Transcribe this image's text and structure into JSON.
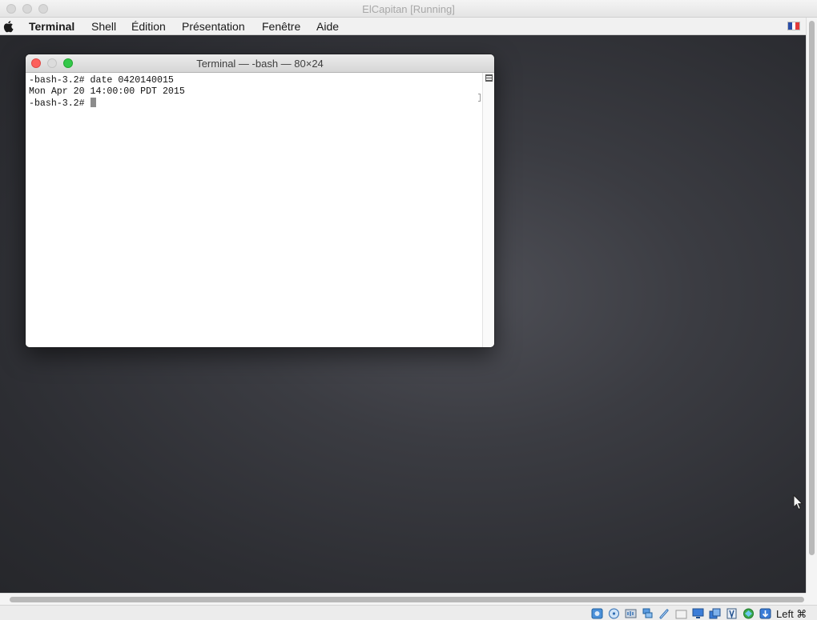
{
  "host_window": {
    "title": "ElCapitan [Running]"
  },
  "menubar": {
    "items": [
      {
        "label": "Terminal"
      },
      {
        "label": "Shell"
      },
      {
        "label": "Édition"
      },
      {
        "label": "Présentation"
      },
      {
        "label": "Fenêtre"
      },
      {
        "label": "Aide"
      }
    ],
    "input_source_icon": "french-flag-icon"
  },
  "terminal": {
    "title": "Terminal — -bash — 80×24",
    "lines": [
      "-bash-3.2# date 0420140015",
      "Mon Apr 20 14:00:00 PDT 2015",
      "-bash-3.2# "
    ]
  },
  "statusbar": {
    "icons": [
      "hard-disk-icon",
      "optical-drive-icon",
      "audio-icon",
      "network-icon",
      "usb-icon",
      "shared-folder-icon",
      "display-icon",
      "video-capture-icon",
      "recording-icon",
      "cpu-icon",
      "virtualization-icon",
      "mouse-integration-icon"
    ],
    "host_key": "Left ⌘"
  },
  "colors": {
    "close": "#fc605c",
    "minimize": "#dcdcdc",
    "zoom": "#34c84a",
    "desktop": "#3b3c42"
  }
}
